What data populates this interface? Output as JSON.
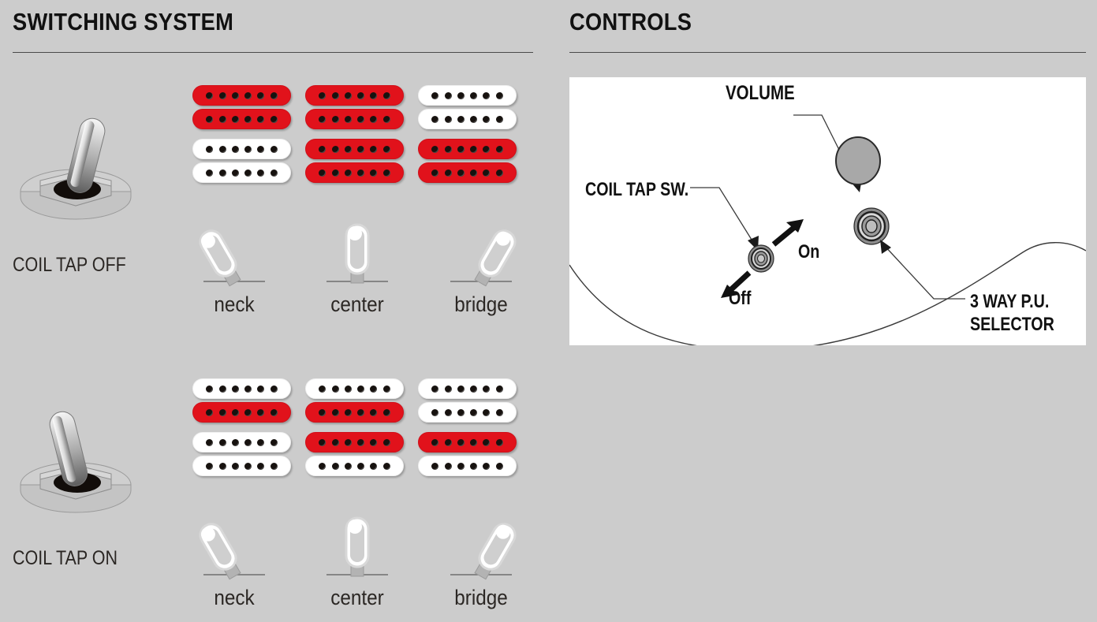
{
  "sections": {
    "switching": {
      "title": "SWITCHING SYSTEM"
    },
    "controls": {
      "title": "CONTROLS"
    }
  },
  "colors": {
    "background": "#cccccc",
    "panel": "#ffffff",
    "coil_active": "#e1121b",
    "coil_inactive": "#ffffff",
    "pole_piece": "#17120f",
    "text": "#2b2724",
    "rule": "#4a4a4a",
    "knob_fill": "#a8a8a8",
    "lever_light": "#ffffff",
    "lever_dark": "#6d6d6d"
  },
  "switching": {
    "modes": [
      {
        "id": "coil-tap-off",
        "label": "COIL TAP OFF",
        "toggle_state": "off",
        "toggle_direction": "right",
        "positions": [
          {
            "name": "neck",
            "label": "neck",
            "blade": "left",
            "pickups": [
              {
                "slot": "neck",
                "coils": [
                  "active",
                  "active"
                ]
              },
              {
                "slot": "bridge",
                "coils": [
                  "inactive",
                  "inactive"
                ]
              }
            ]
          },
          {
            "name": "center",
            "label": "center",
            "blade": "center",
            "pickups": [
              {
                "slot": "neck",
                "coils": [
                  "active",
                  "active"
                ]
              },
              {
                "slot": "bridge",
                "coils": [
                  "active",
                  "active"
                ]
              }
            ]
          },
          {
            "name": "bridge",
            "label": "bridge",
            "blade": "right",
            "pickups": [
              {
                "slot": "neck",
                "coils": [
                  "inactive",
                  "inactive"
                ]
              },
              {
                "slot": "bridge",
                "coils": [
                  "active",
                  "active"
                ]
              }
            ]
          }
        ]
      },
      {
        "id": "coil-tap-on",
        "label": "COIL TAP ON",
        "toggle_state": "on",
        "toggle_direction": "left",
        "positions": [
          {
            "name": "neck",
            "label": "neck",
            "blade": "left",
            "pickups": [
              {
                "slot": "neck",
                "coils": [
                  "inactive",
                  "active"
                ]
              },
              {
                "slot": "bridge",
                "coils": [
                  "inactive",
                  "inactive"
                ]
              }
            ]
          },
          {
            "name": "center",
            "label": "center",
            "blade": "center",
            "pickups": [
              {
                "slot": "neck",
                "coils": [
                  "inactive",
                  "active"
                ]
              },
              {
                "slot": "bridge",
                "coils": [
                  "active",
                  "inactive"
                ]
              }
            ]
          },
          {
            "name": "bridge",
            "label": "bridge",
            "blade": "right",
            "pickups": [
              {
                "slot": "neck",
                "coils": [
                  "inactive",
                  "inactive"
                ]
              },
              {
                "slot": "bridge",
                "coils": [
                  "active",
                  "inactive"
                ]
              }
            ]
          }
        ]
      }
    ],
    "poles_per_coil": 6
  },
  "controls": {
    "callouts": {
      "volume": "VOLUME",
      "coil_tap_sw": "COIL TAP SW.",
      "selector_line1": "3 WAY P.U.",
      "selector_line2": "SELECTOR"
    },
    "switch_positions": {
      "on": "On",
      "off": "Off"
    },
    "parts": [
      {
        "name": "volume-knob",
        "type": "rotary-knob"
      },
      {
        "name": "coil-tap-switch",
        "type": "mini-toggle"
      },
      {
        "name": "three-way-selector",
        "type": "rotary-selector"
      }
    ]
  }
}
